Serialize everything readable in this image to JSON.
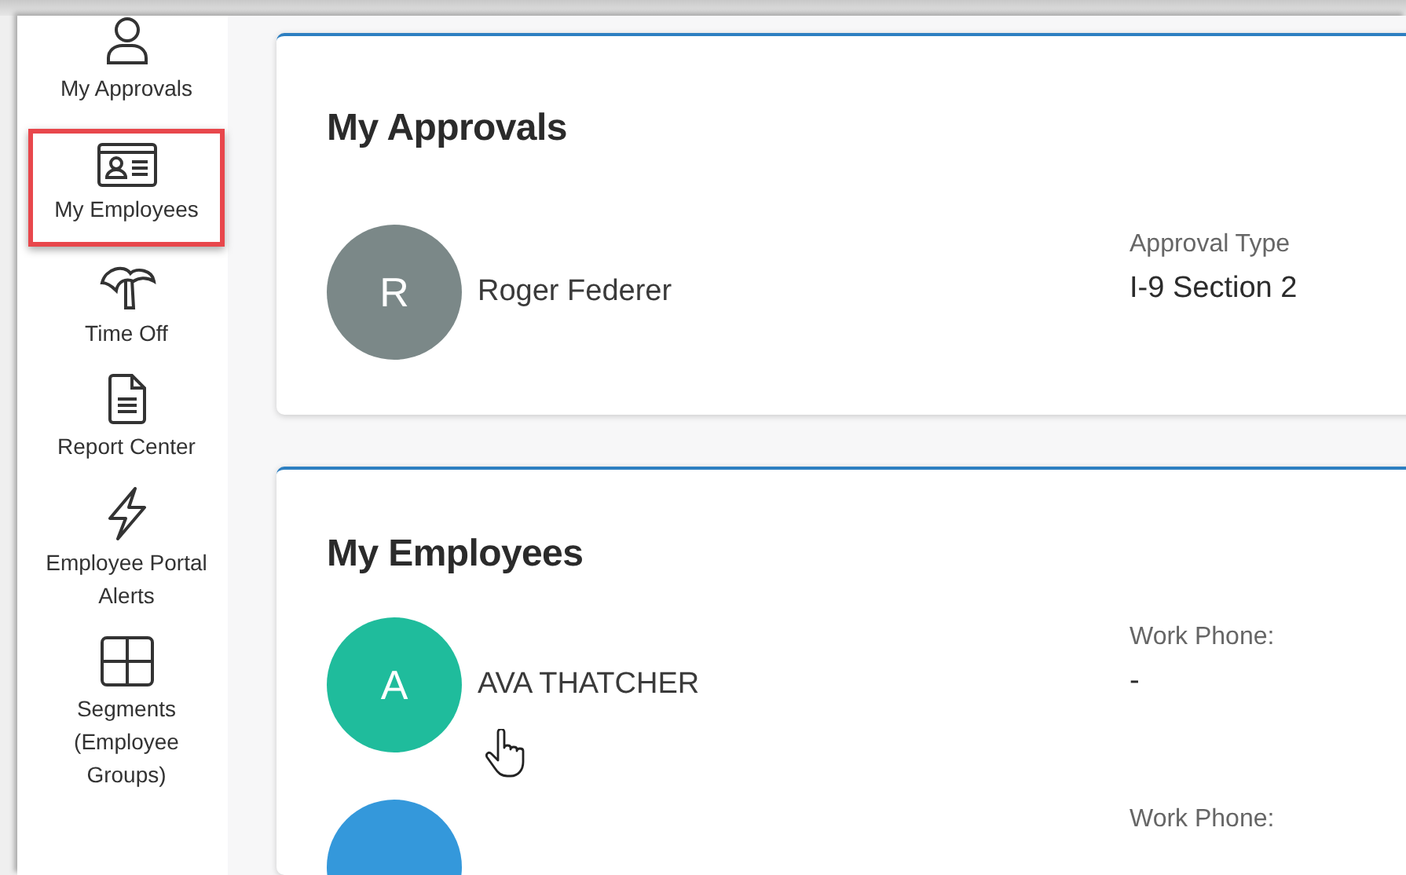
{
  "sidebar": {
    "items": [
      {
        "kind": "person",
        "label": "My Approvals",
        "selected": false
      },
      {
        "kind": "id-card",
        "label": "My Employees",
        "selected": true
      },
      {
        "kind": "palm",
        "label": "Time Off",
        "selected": false
      },
      {
        "kind": "document",
        "label": "Report Center",
        "selected": false
      },
      {
        "kind": "bolt",
        "label": "Employee Portal Alerts",
        "selected": false
      },
      {
        "kind": "grid",
        "label": "Segments (Employee Groups)",
        "selected": false
      }
    ]
  },
  "approvals": {
    "title": "My Approvals",
    "rows": [
      {
        "initial": "R",
        "color": "#7b8888",
        "name": "Roger Federer",
        "field_label": "Approval Type",
        "field_value": "I-9 Section 2"
      }
    ]
  },
  "employees": {
    "title": "My Employees",
    "rows": [
      {
        "initial": "A",
        "color": "#1fbc9c",
        "name": "AVA THATCHER",
        "field_label": "Work Phone:",
        "field_value": "-"
      },
      {
        "color": "#3498db",
        "field_label": "Work Phone:"
      }
    ]
  }
}
